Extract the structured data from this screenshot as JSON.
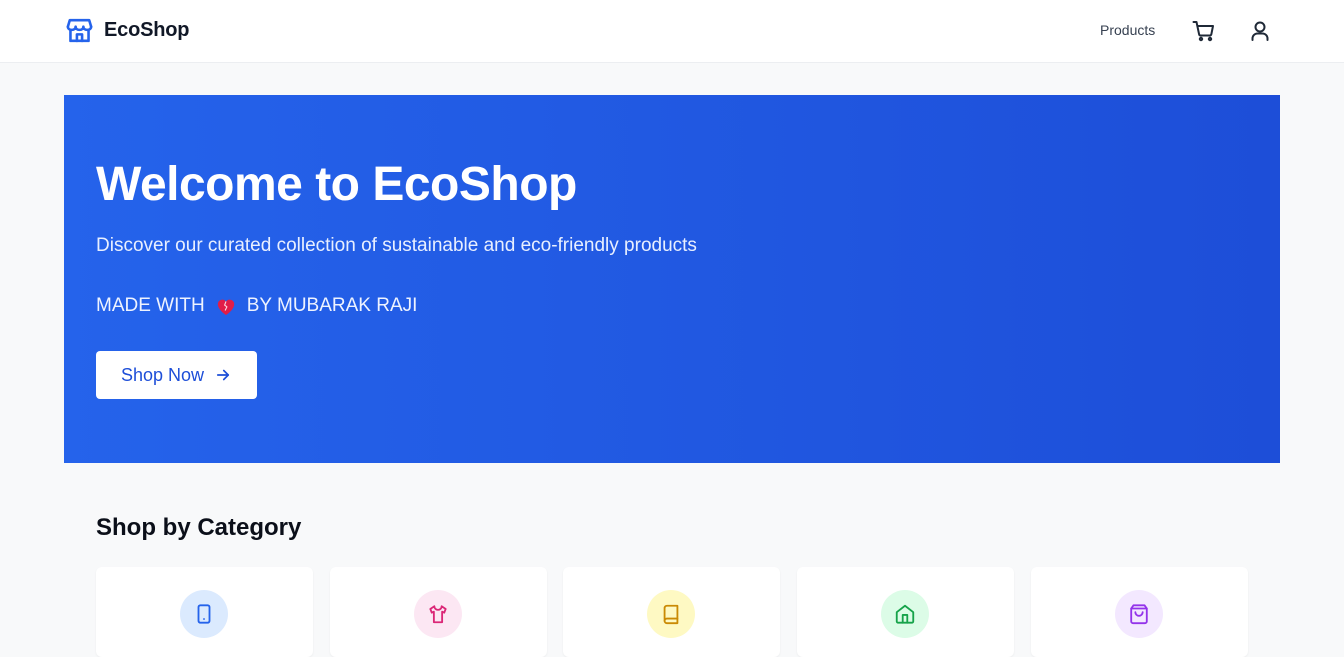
{
  "header": {
    "brand": "EcoShop",
    "nav_products": "Products"
  },
  "hero": {
    "title": "Welcome to EcoShop",
    "subtitle": "Discover our curated collection of sustainable and eco-friendly products",
    "credit_prefix": "MADE WITH",
    "credit_suffix": "BY MUBARAK RAJI",
    "cta_label": "Shop Now"
  },
  "categories": {
    "title": "Shop by Category",
    "items": [
      {
        "icon": "smartphone-icon",
        "bg": "#dbeafe",
        "color": "#2563eb"
      },
      {
        "icon": "shirt-icon",
        "bg": "#fce7f3",
        "color": "#db2777"
      },
      {
        "icon": "book-icon",
        "bg": "#fef9c3",
        "color": "#ca8a04"
      },
      {
        "icon": "home-icon",
        "bg": "#dcfce7",
        "color": "#16a34a"
      },
      {
        "icon": "shopping-bag-icon",
        "bg": "#f3e8ff",
        "color": "#9333ea"
      }
    ]
  },
  "colors": {
    "brand": "#2563eb",
    "hero_start": "#2563eb",
    "hero_end": "#1d4ed8",
    "heart": "#e11d48"
  }
}
